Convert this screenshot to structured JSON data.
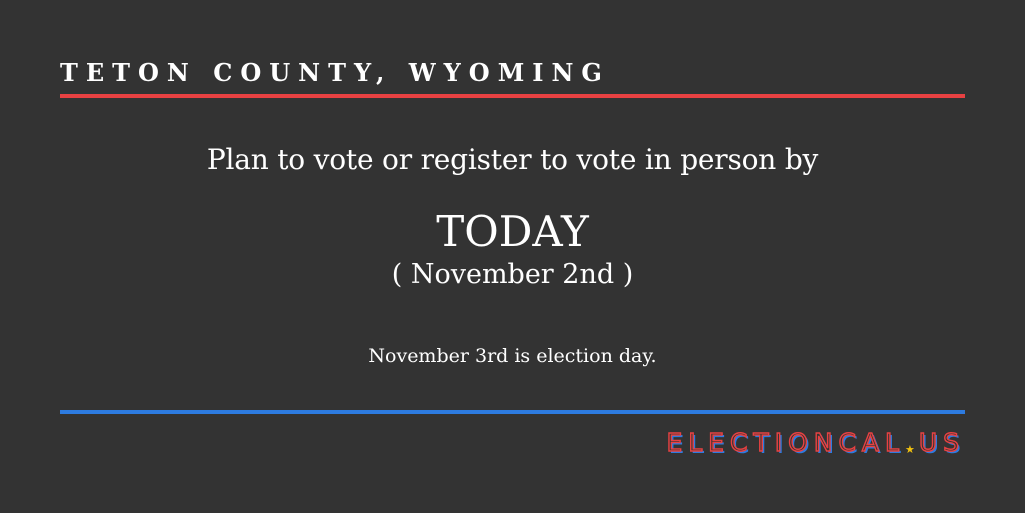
{
  "header": {
    "county": "TETON COUNTY, WYOMING"
  },
  "main": {
    "lead": "Plan to vote or register to vote in person by",
    "deadline": "TODAY",
    "deadline_date": "( November 2nd )",
    "note": "November 3rd is election day."
  },
  "footer": {
    "brand_left": "ELECTIONCAL",
    "brand_star": "★",
    "brand_right": "US"
  },
  "colors": {
    "background": "#333333",
    "text": "#ffffff",
    "accent_red": "#e84142",
    "accent_blue": "#2d7be0",
    "star_yellow": "#f2c20f"
  }
}
